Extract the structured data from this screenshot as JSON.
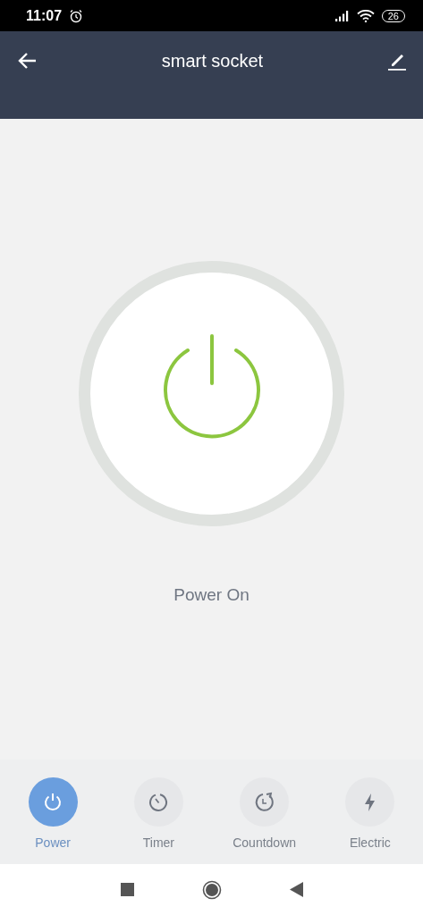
{
  "status_bar": {
    "time": "11:07",
    "battery": "26"
  },
  "header": {
    "title": "smart socket"
  },
  "switch": {
    "on": true,
    "status": "Power On"
  },
  "tabs": [
    {
      "label": "Power",
      "kind": "power",
      "selected": true
    },
    {
      "label": "Timer",
      "kind": "timer",
      "selected": false
    },
    {
      "label": "Countdown",
      "kind": "countdown",
      "selected": false
    },
    {
      "label": "Electric",
      "kind": "electric",
      "selected": false
    }
  ]
}
